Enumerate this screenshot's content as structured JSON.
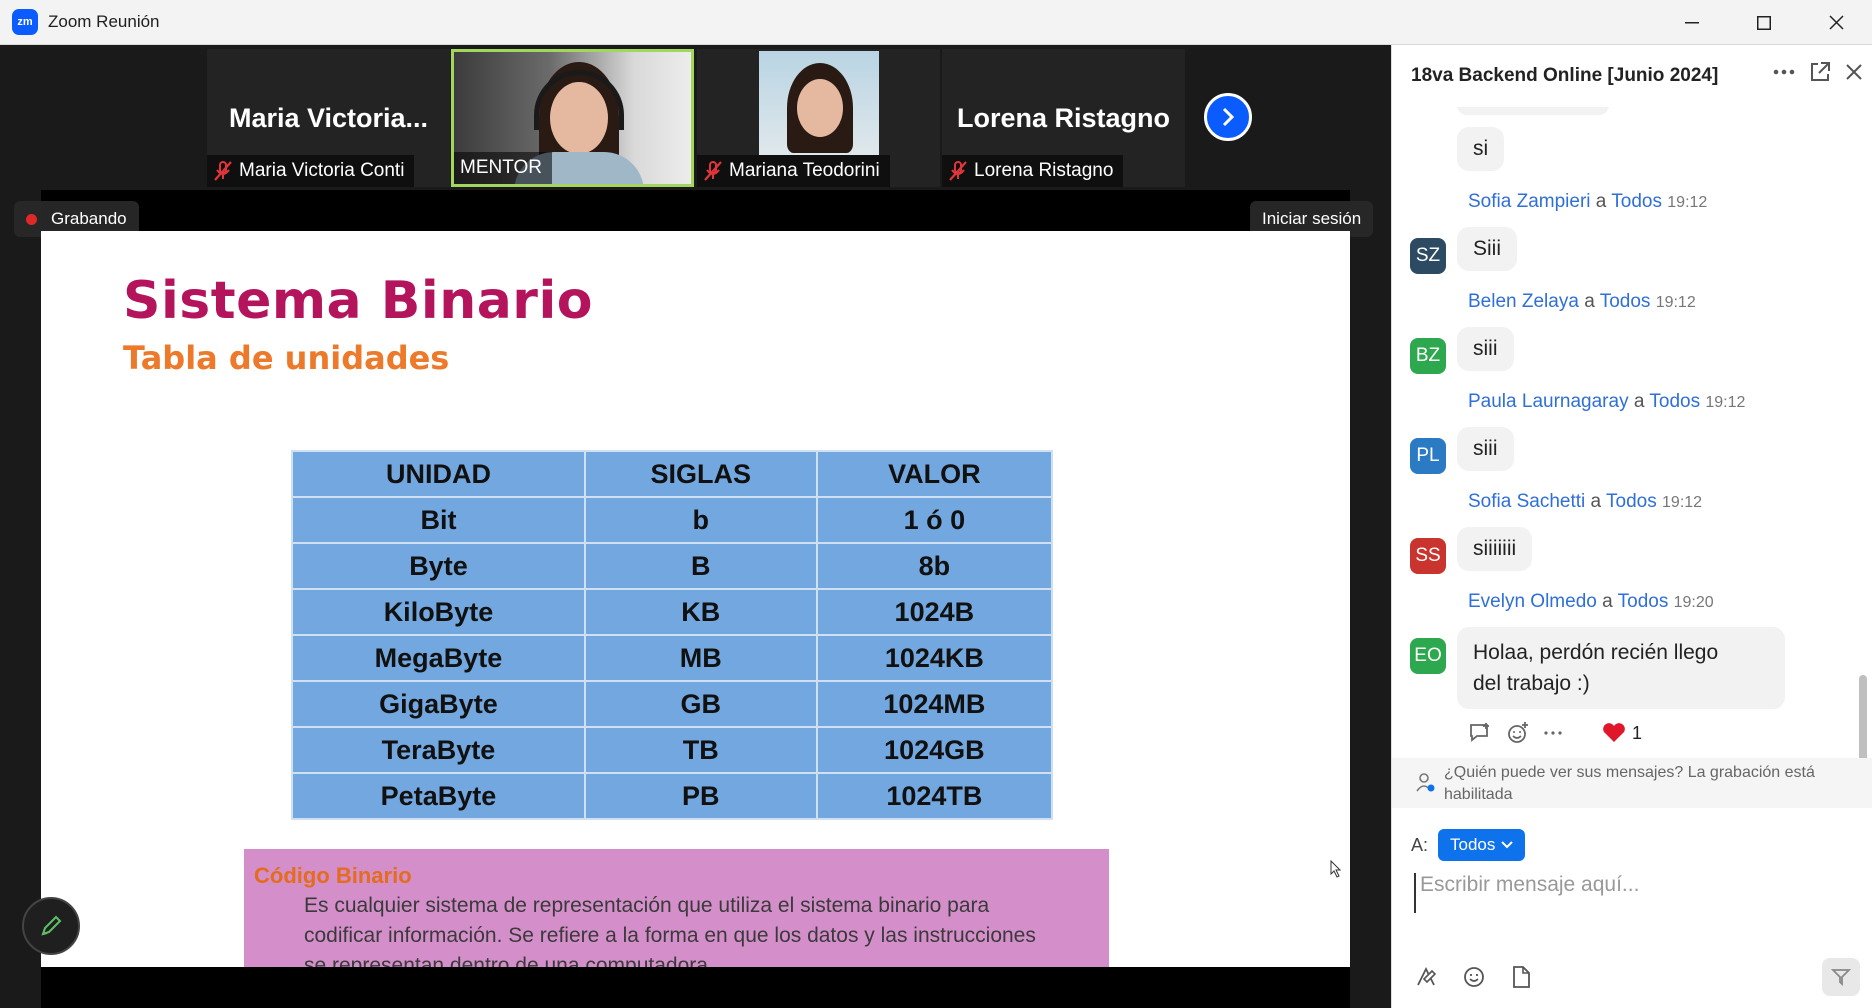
{
  "window": {
    "title": "Zoom Reunión",
    "logo": "zm"
  },
  "participants": [
    {
      "big_name": "Maria  Victoria...",
      "label": "Maria Victoria Conti",
      "muted": true
    },
    {
      "big_name": "",
      "label": "MENTOR",
      "muted": false
    },
    {
      "big_name": "",
      "label": "Mariana Teodorini",
      "muted": true
    },
    {
      "big_name": "Lorena Ristagno",
      "label": "Lorena Ristagno",
      "muted": true
    }
  ],
  "recording": {
    "label": "Grabando",
    "color": "#e02828"
  },
  "signin": {
    "label": "Iniciar sesión"
  },
  "slide": {
    "title": "Sistema Binario",
    "subtitle": "Tabla de unidades",
    "table": {
      "headers": [
        "UNIDAD",
        "SIGLAS",
        "VALOR"
      ],
      "rows": [
        [
          "Bit",
          "b",
          "1 ó 0"
        ],
        [
          "Byte",
          "B",
          "8b"
        ],
        [
          "KiloByte",
          "KB",
          "1024B"
        ],
        [
          "MegaByte",
          "MB",
          "1024KB"
        ],
        [
          "GigaByte",
          "GB",
          "1024MB"
        ],
        [
          "TeraByte",
          "TB",
          "1024GB"
        ],
        [
          "PetaByte",
          "PB",
          "1024TB"
        ]
      ]
    },
    "definition": {
      "heading": "Código Binario",
      "lines": [
        "Es cualquier sistema de representación que utiliza el sistema binario para",
        "codificar información. Se refiere a la forma en que los datos y las instrucciones",
        "se representan dentro de una computadora"
      ]
    }
  },
  "chat": {
    "title": "18va Backend Online [Junio 2024]",
    "first_message": "si",
    "messages": [
      {
        "initials": "SZ",
        "color": "#2d4a63",
        "name": "Sofia Zampieri",
        "to_word": "a",
        "to": "Todos",
        "time": "19:12",
        "text": "Siii"
      },
      {
        "initials": "BZ",
        "color": "#2ea84f",
        "name": "Belen Zelaya",
        "to_word": "a",
        "to": "Todos",
        "time": "19:12",
        "text": "siii"
      },
      {
        "initials": "PL",
        "color": "#2b7bc4",
        "name": "Paula Laurnagaray",
        "to_word": "a",
        "to": "Todos",
        "time": "19:12",
        "text": "siii"
      },
      {
        "initials": "SS",
        "color": "#c9342f",
        "name": "Sofia Sachetti",
        "to_word": "a",
        "to": "Todos",
        "time": "19:12",
        "text": "siiiiiii"
      },
      {
        "initials": "EO",
        "color": "#2ea84f",
        "name": "Evelyn Olmedo",
        "to_word": "a",
        "to": "Todos",
        "time": "19:20",
        "text_line1": "Holaa, perdón recién llego",
        "text_line2": "del trabajo :)"
      }
    ],
    "reaction_count": "1",
    "notice": "¿Quién puede ver sus mensajes? La grabación está habilitada",
    "to_label": "A:",
    "recipient": "Todos",
    "input_placeholder": "Escribir mensaje aquí..."
  }
}
